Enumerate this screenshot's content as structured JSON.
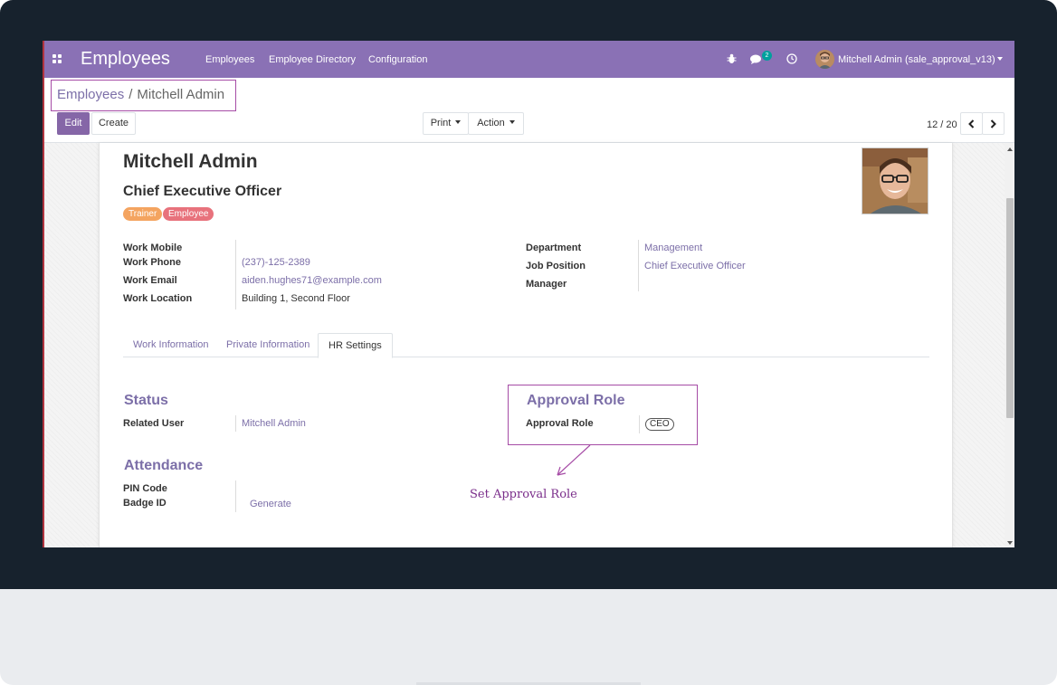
{
  "navbar": {
    "brand": "Employees",
    "menu": [
      "Employees",
      "Employee Directory",
      "Configuration"
    ],
    "chat_badge": "2",
    "user": "Mitchell Admin (sale_approval_v13)",
    "bg_color": "#8a71b5"
  },
  "breadcrumb": {
    "parent": "Employees",
    "separator": "/",
    "current": "Mitchell Admin"
  },
  "toolbar": {
    "edit": "Edit",
    "create": "Create",
    "print": "Print",
    "action": "Action",
    "pager": "12 / 20"
  },
  "employee": {
    "name": "Mitchell Admin",
    "job_title": "Chief Executive Officer",
    "tags": [
      {
        "label": "Trainer",
        "color": "#f4a460"
      },
      {
        "label": "Employee",
        "color": "#e8727c"
      }
    ]
  },
  "contact": {
    "work_mobile_label": "Work Mobile",
    "work_mobile": "",
    "work_phone_label": "Work Phone",
    "work_phone": "(237)-125-2389",
    "work_email_label": "Work Email",
    "work_email": "aiden.hughes71@example.com",
    "work_location_label": "Work Location",
    "work_location": "Building 1, Second Floor"
  },
  "org": {
    "department_label": "Department",
    "department": "Management",
    "job_position_label": "Job Position",
    "job_position": "Chief Executive Officer",
    "manager_label": "Manager",
    "manager": ""
  },
  "tabs": [
    "Work Information",
    "Private Information",
    "HR Settings"
  ],
  "active_tab": "HR Settings",
  "status": {
    "title": "Status",
    "related_user_label": "Related User",
    "related_user": "Mitchell Admin"
  },
  "attendance": {
    "title": "Attendance",
    "pin_label": "PIN Code",
    "badge_label": "Badge ID",
    "generate": "Generate"
  },
  "approval": {
    "title": "Approval Role",
    "label": "Approval Role",
    "value": "CEO"
  },
  "annotation": "Set Approval Role",
  "accent_color": "#7c6fa8",
  "highlight_color": "#a64ca6"
}
